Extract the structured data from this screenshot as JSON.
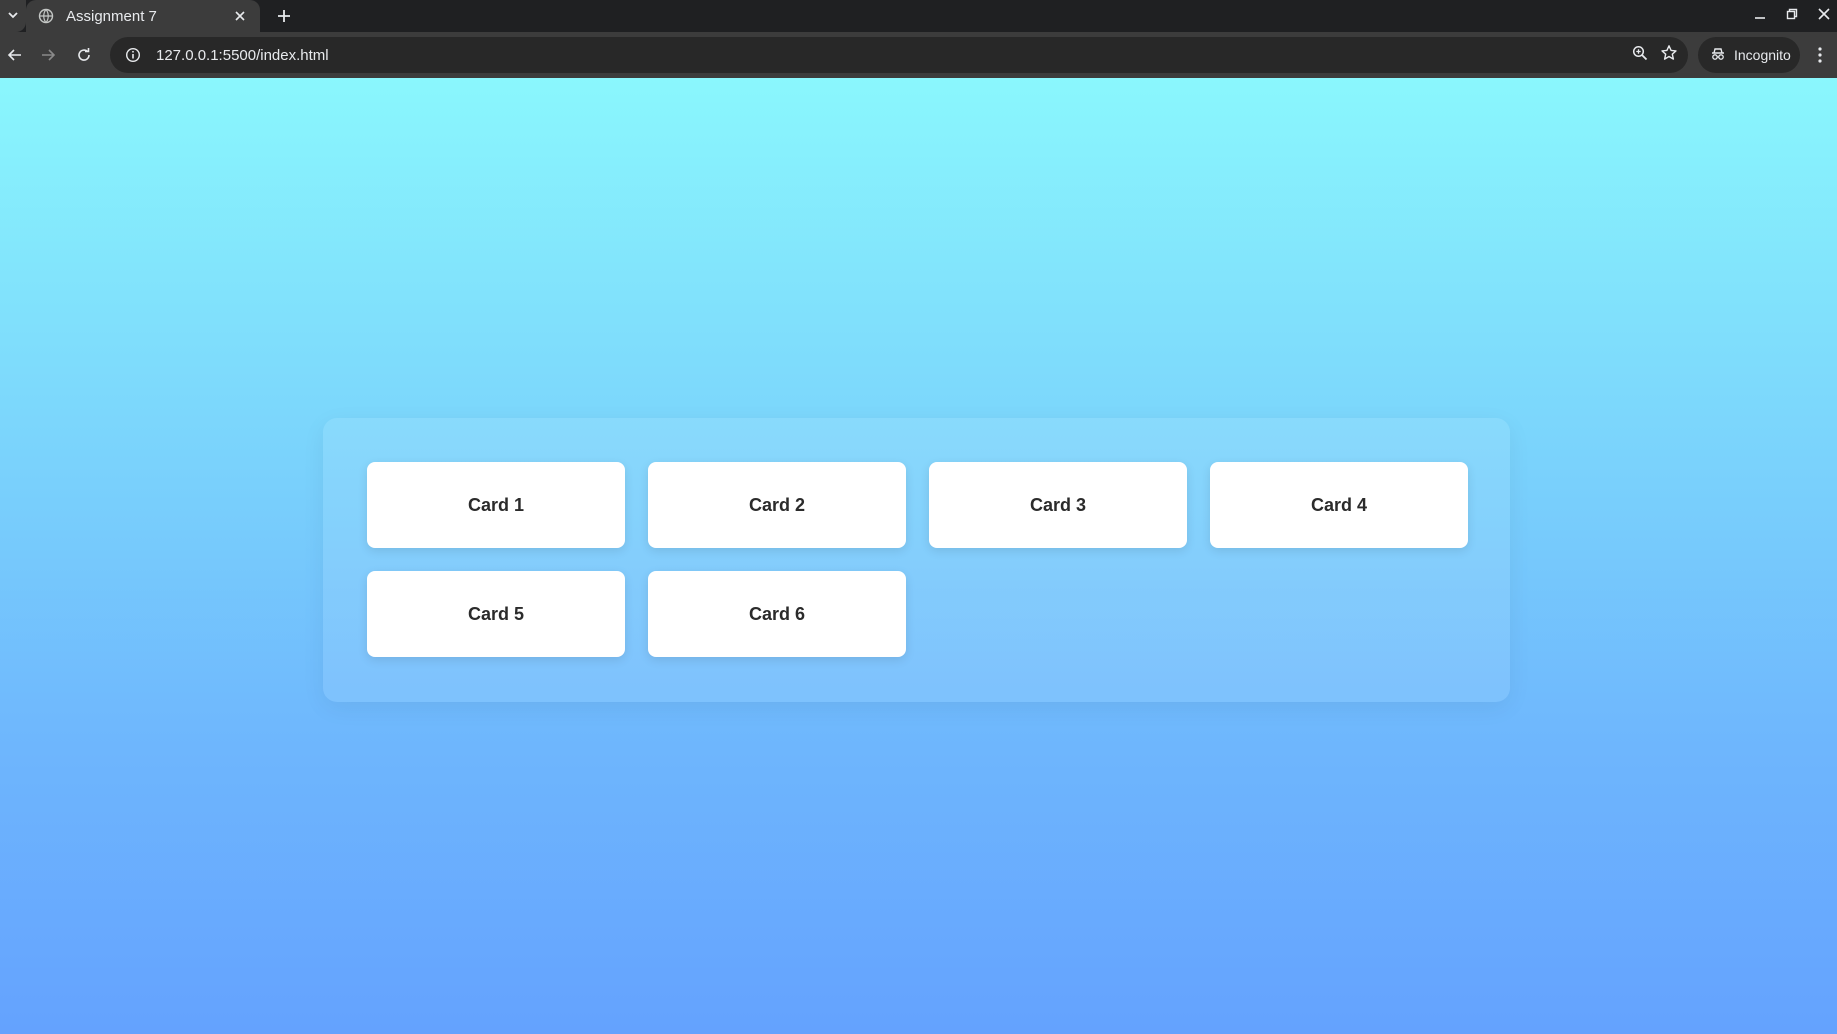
{
  "browser": {
    "tab_title": "Assignment 7",
    "url": "127.0.0.1:5500/index.html",
    "profile_label": "Incognito"
  },
  "colors": {
    "gradient_top": "#8af7fd",
    "gradient_bottom": "#64a2fe",
    "card_background": "#ffffff",
    "card_text": "#2b2b2b"
  },
  "cards": [
    {
      "label": "Card 1"
    },
    {
      "label": "Card 2"
    },
    {
      "label": "Card 3"
    },
    {
      "label": "Card 4"
    },
    {
      "label": "Card 5"
    },
    {
      "label": "Card 6"
    }
  ]
}
